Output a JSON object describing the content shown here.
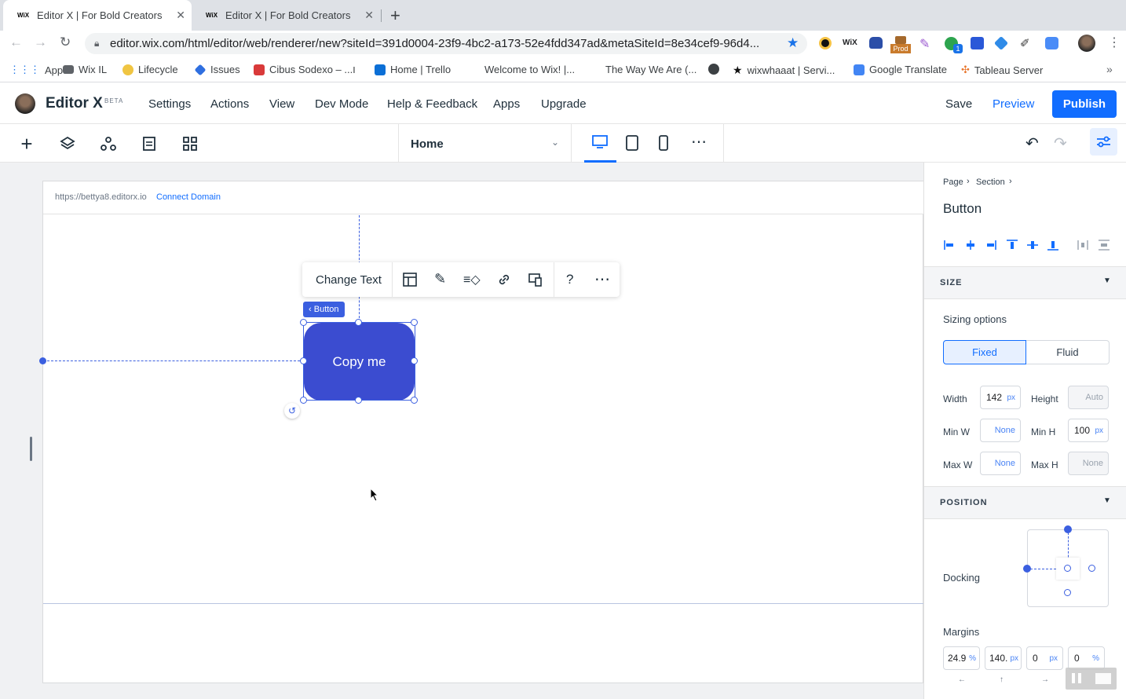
{
  "browser": {
    "tabs": [
      {
        "favicon": "WiX",
        "title": "Editor X | For Bold Creators"
      },
      {
        "favicon": "WiX",
        "title": "Editor X | For Bold Creators"
      }
    ],
    "url": "editor.wix.com/html/editor/web/renderer/new?siteId=391d0004-23f9-4bc2-a173-52e4fdd347ad&metaSiteId=8e34cef9-96d4...",
    "bookmarks": [
      "Apps",
      "Wix IL",
      "Lifecycle",
      "Issues",
      "Cibus Sodexo – ...ו",
      "Home | Trello",
      "Welcome to Wix! |...",
      "The Way We Are (...",
      "wixwhaaat | Servi...",
      "Google Translate",
      "Tableau Server"
    ],
    "extension_badge": "Prod"
  },
  "editor": {
    "brand": "Editor X",
    "brand_badge": "BETA",
    "menu": [
      "Settings",
      "Actions",
      "View",
      "Dev Mode",
      "Help & Feedback",
      "Apps",
      "Upgrade"
    ],
    "save": "Save",
    "preview": "Preview",
    "publish": "Publish",
    "page_select": "Home",
    "accent": "#116dff"
  },
  "canvas": {
    "site_url": "https://bettya8.editorx.io",
    "connect_domain": "Connect Domain",
    "float_toolbar_change_text": "Change Text",
    "float_toolbar_help": "?",
    "element_tag": "Button",
    "button_label": "Copy me",
    "button_color": "#3b4cd0"
  },
  "panel": {
    "breadcrumb": [
      "Page",
      "Section"
    ],
    "title": "Button",
    "size_header": "SIZE",
    "sizing_options_label": "Sizing options",
    "fixed": "Fixed",
    "fluid": "Fluid",
    "width_label": "Width",
    "width_value": "142",
    "width_unit": "px",
    "height_label": "Height",
    "height_value": "Auto",
    "minw_label": "Min W",
    "minw_value": "None",
    "minh_label": "Min H",
    "minh_value": "100",
    "minh_unit": "px",
    "maxw_label": "Max W",
    "maxw_value": "None",
    "maxh_label": "Max H",
    "maxh_value": "None",
    "position_header": "POSITION",
    "docking_label": "Docking",
    "margins_label": "Margins",
    "margins": [
      {
        "value": "24.9",
        "unit": "%"
      },
      {
        "value": "140.",
        "unit": "px"
      },
      {
        "value": "0",
        "unit": "px"
      },
      {
        "value": "0",
        "unit": "%"
      }
    ]
  }
}
